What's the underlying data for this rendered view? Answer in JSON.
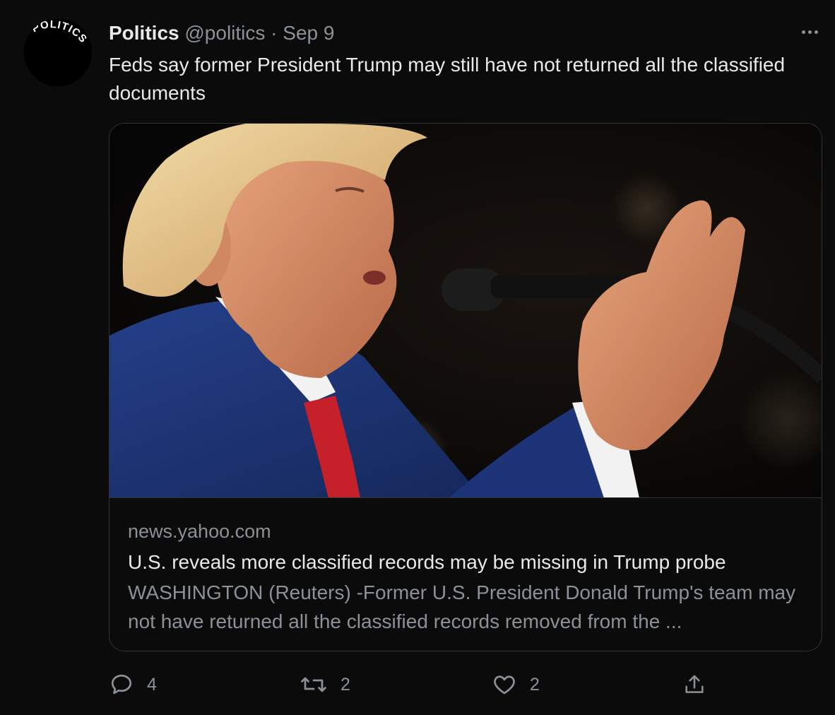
{
  "account": {
    "name": "Politics",
    "handle": "@politics",
    "separator": "·",
    "date": "Sep 9",
    "avatar_text": "POLITICS"
  },
  "tweet": {
    "text": "Feds say former President Trump may still have not returned all the classified documents"
  },
  "card": {
    "image_alt": "Former President Trump speaking at a microphone",
    "domain": "news.yahoo.com",
    "title": "U.S. reveals more classified records may be missing in Trump probe",
    "description": "WASHINGTON (Reuters) -Former U.S. President Donald Trump's team may not have returned all the classified records removed from the ..."
  },
  "actions": {
    "reply": {
      "icon": "reply-icon",
      "count": "4"
    },
    "retweet": {
      "icon": "retweet-icon",
      "count": "2"
    },
    "like": {
      "icon": "heart-icon",
      "count": "2"
    },
    "share": {
      "icon": "share-icon"
    }
  },
  "colors": {
    "background": "#0b0b0b",
    "primary_text": "#e7e9ea",
    "secondary_text": "#8b9197",
    "border": "#2f3336"
  }
}
